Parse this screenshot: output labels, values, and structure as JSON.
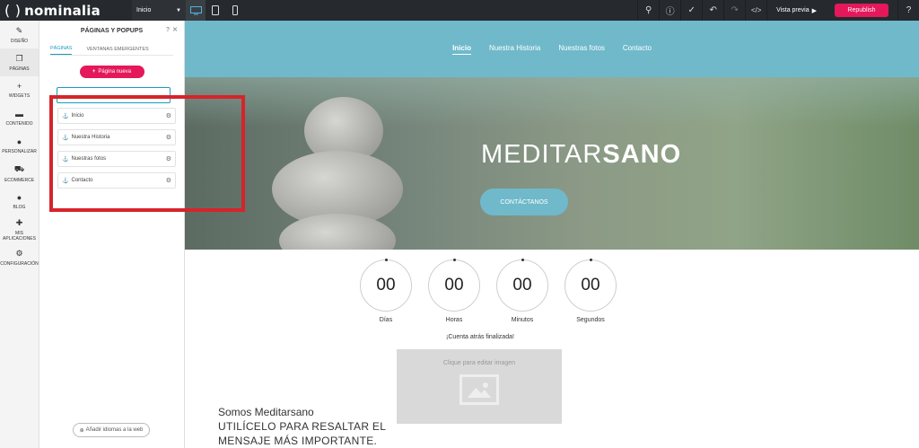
{
  "topbar": {
    "logo_text": "nominalia",
    "page_select": "Inicio",
    "preview_label": "Vista previa",
    "republish_label": "Republish"
  },
  "rail": {
    "items": [
      {
        "label": "DISEÑO",
        "icon": "brush-icon"
      },
      {
        "label": "PÁGINAS",
        "icon": "pages-icon"
      },
      {
        "label": "WIDGETS",
        "icon": "plus-icon"
      },
      {
        "label": "CONTENIDO",
        "icon": "folder-icon"
      },
      {
        "label": "PERSONALIZAR",
        "icon": "person-icon"
      },
      {
        "label": "ECOMMERCE",
        "icon": "cart-icon"
      },
      {
        "label": "BLOG",
        "icon": "chat-icon"
      },
      {
        "label": "MIS APLICACIONES",
        "icon": "puzzle-icon"
      },
      {
        "label": "CONFIGURACIÓN",
        "icon": "gear-icon"
      }
    ]
  },
  "panel": {
    "title": "PÁGINAS Y POPUPS",
    "tabs": [
      "PÁGINAS",
      "VENTANAS EMERGENTES"
    ],
    "new_page_label": "Página nueva",
    "pages": [
      "Inicio",
      "Nuestra Historia",
      "Nuestras fotos",
      "Contacto"
    ],
    "add_languages_label": "Añadir idiomas a la web"
  },
  "site": {
    "nav": [
      "Inicio",
      "Nuestra Historia",
      "Nuestras fotos",
      "Contacto"
    ],
    "hero_title_light": "MEDITAR",
    "hero_title_bold": "SANO",
    "cta_label": "CONTÁCTANOS",
    "countdown": [
      {
        "value": "00",
        "label": "Días"
      },
      {
        "value": "00",
        "label": "Horas"
      },
      {
        "value": "00",
        "label": "Minutos"
      },
      {
        "value": "00",
        "label": "Segundos"
      }
    ],
    "countdown_finished": "¡Cuenta atrás finalizada!",
    "image_placeholder": "Clique para editar imagen",
    "heading_line": "Somos Meditarsano",
    "body_text": "UTILÍCELO PARA RESALTAR EL MENSAJE MÁS IMPORTANTE."
  },
  "colors": {
    "accent": "#e4185a",
    "site_accent": "#6fb9cb",
    "highlight_box": "#d6242a"
  }
}
